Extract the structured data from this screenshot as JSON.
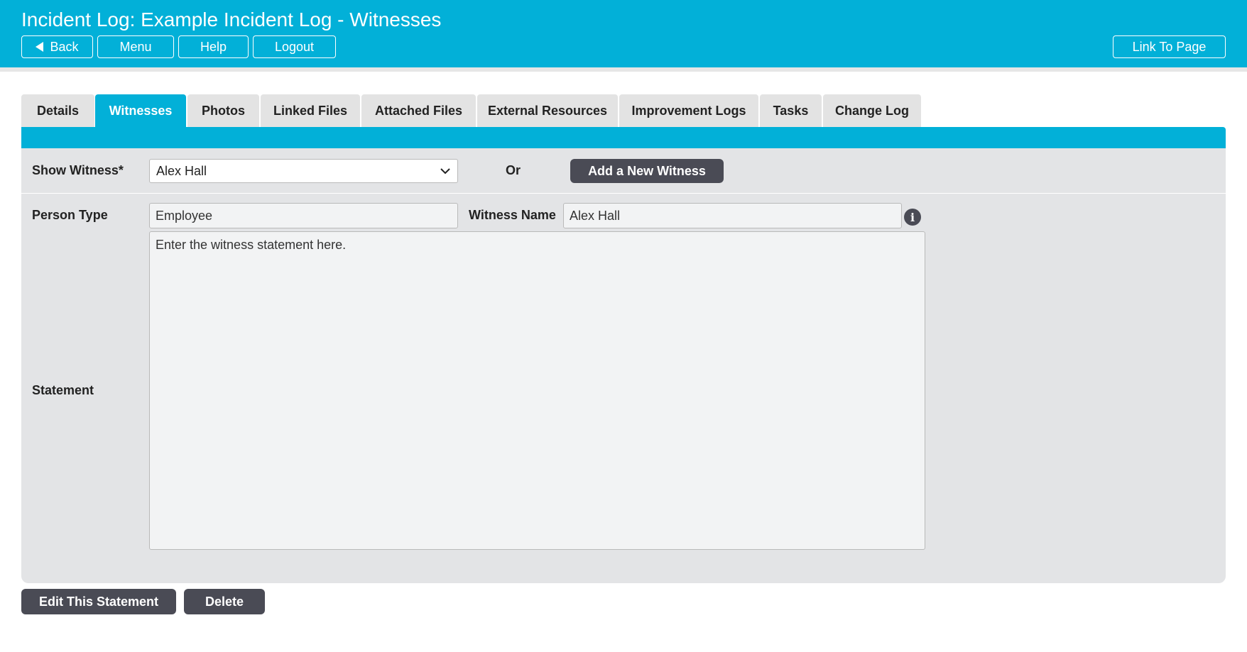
{
  "header": {
    "title": "Incident Log: Example Incident Log - Witnesses",
    "buttons": {
      "back": "Back",
      "menu": "Menu",
      "help": "Help",
      "logout": "Logout",
      "link_to_page": "Link To Page"
    },
    "background_color": "#02b0d8"
  },
  "tabs": [
    {
      "label": "Details",
      "active": false
    },
    {
      "label": "Witnesses",
      "active": true
    },
    {
      "label": "Photos",
      "active": false
    },
    {
      "label": "Linked Files",
      "active": false
    },
    {
      "label": "Attached Files",
      "active": false
    },
    {
      "label": "External Resources",
      "active": false
    },
    {
      "label": "Improvement Logs",
      "active": false
    },
    {
      "label": "Tasks",
      "active": false
    },
    {
      "label": "Change Log",
      "active": false
    }
  ],
  "form": {
    "show_witness_label": "Show Witness*",
    "show_witness_value": "Alex Hall",
    "or_label": "Or",
    "add_new_witness_button": "Add a New Witness",
    "person_type_label": "Person Type",
    "person_type_value": "Employee",
    "witness_name_label": "Witness Name",
    "witness_name_value": "Alex Hall",
    "info_icon_glyph": "i",
    "statement_label": "Statement",
    "statement_value": "Enter the witness statement here."
  },
  "actions": {
    "edit_statement": "Edit This Statement",
    "delete": "Delete"
  },
  "colors": {
    "accent": "#02b0d8",
    "dark_button": "#4a4b55",
    "panel": "#e3e4e6"
  }
}
